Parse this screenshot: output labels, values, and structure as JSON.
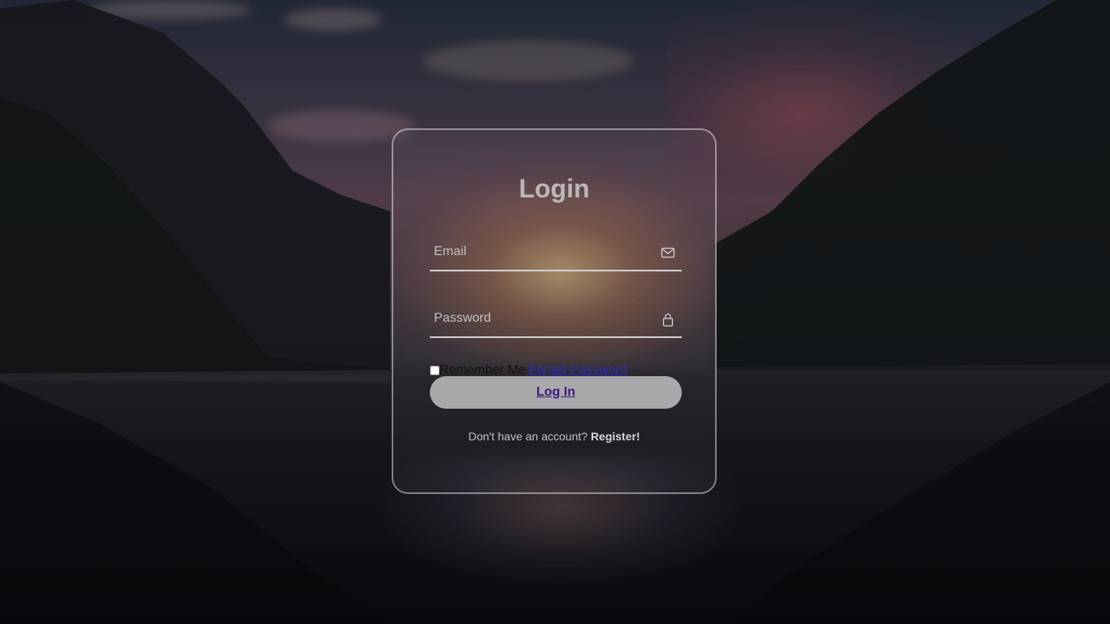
{
  "login": {
    "title": "Login",
    "email": {
      "placeholder": "Email",
      "value": "",
      "icon": "mail-icon"
    },
    "password": {
      "placeholder": "Password",
      "value": "",
      "icon": "lock-icon"
    },
    "remember_label": "Remember Me",
    "remember_checked": false,
    "forget_password_label": "Forget Password",
    "login_button_label": "Log In",
    "register_prompt": "Don't have an account?",
    "register_link": "Register!"
  },
  "colors": {
    "card_border": "#bdbdbd",
    "button_bg": "#a9a9ab",
    "title_text": "#b8b8b8",
    "link_blue": "#2b2fc2"
  }
}
